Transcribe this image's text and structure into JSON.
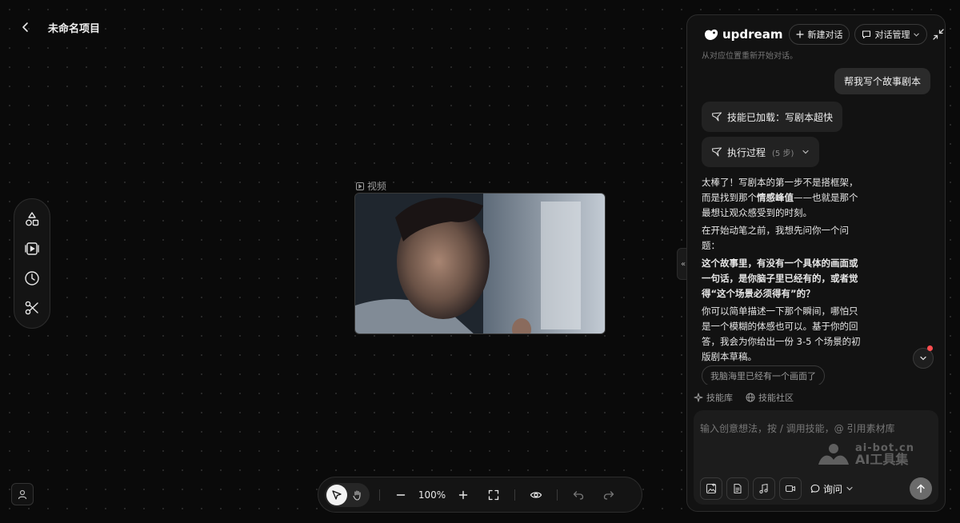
{
  "header": {
    "project_title": "未命名项目"
  },
  "canvas": {
    "video_node": {
      "label": "视频"
    }
  },
  "bottom_toolbar": {
    "zoom_level": "100%"
  },
  "chat": {
    "logo_text": "updream",
    "new_chat_label": "新建对话",
    "manage_chat_label": "对话管理",
    "faded_prev_text": "从对应位置重新开始对话。",
    "user_message": "帮我写个故事剧本",
    "skill_loaded": "技能已加载：写剧本超快",
    "process_label": "执行过程",
    "process_steps": "(5 步)",
    "ai_message": {
      "p1_a": "太棒了！写剧本的第一步不是搭框架，而是找到那个",
      "p1_bold": "情感峰值",
      "p1_b": "——也就是那个最想让观众感受到的时刻。",
      "p2": "在开始动笔之前，我想先问你一个问题：",
      "p3_bold": "这个故事里，有没有一个具体的画面或一句话，是你脑子里已经有的，或者觉得“这个场景必须得有”的？",
      "p4": "你可以简单描述一下那个瞬间，哪怕只是一个模糊的体感也可以。基于你的回答，我会为你给出一份 3-5 个场景的初版剧本草稿。"
    },
    "suggestion_chip": "我脑海里已经有一个画面了",
    "skill_library_label": "技能库",
    "skill_community_label": "技能社区",
    "input_placeholder": "输入创意想法，按 / 调用技能，@ 引用素材库",
    "mode_label": "询问",
    "notif_color": "#ff4d4f"
  },
  "watermark": {
    "url": "ai-bot.cn",
    "name": "AI工具集"
  }
}
